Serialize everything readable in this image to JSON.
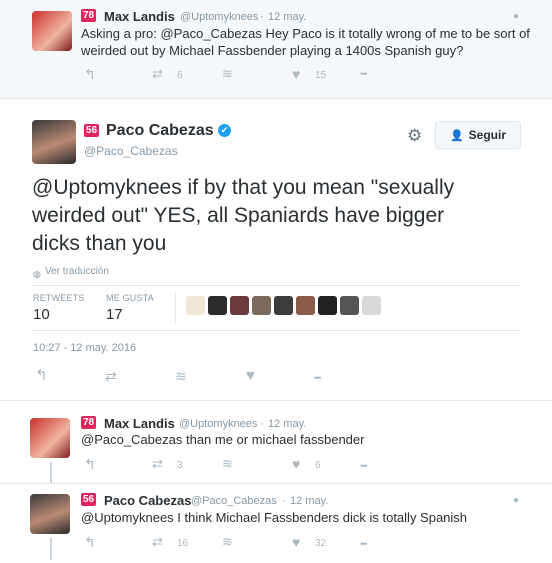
{
  "tweet1": {
    "rank": "78",
    "name": "Max Landis",
    "handle": "@Uptomyknees",
    "separator": "·",
    "time": "12 may.",
    "text_line1": "Asking a pro: @Paco_Cabezas Hey Paco is it totally wrong of me to be sort of",
    "text_line2": "weirded out by Michael Fassbender playing a 1400s Spanish guy?",
    "retweets": "6",
    "likes": "15"
  },
  "main_tweet": {
    "rank": "56",
    "name": "Paco Cabezas",
    "handle": "@Paco_Cabezas",
    "follow_label": "Seguir",
    "text_line1": "@Uptomyknees if by that you mean \"sexually",
    "text_line2": "weirded out\" YES, all Spaniards have bigger",
    "text_line3": "dicks than you",
    "translate": "Ver traducción",
    "retweets_label": "RETWEETS",
    "retweets": "10",
    "likes_label": "ME GUSTA",
    "likes": "17",
    "timestamp": "10:27 - 12 may. 2016"
  },
  "reply1": {
    "rank": "78",
    "name": "Max Landis",
    "handle": "@Uptomyknees",
    "separator": "·",
    "time": "12 may.",
    "text": "@Paco_Cabezas than me or michael fassbender",
    "retweets": "3",
    "likes": "6"
  },
  "reply2": {
    "rank": "56",
    "name": "Paco Cabezas",
    "handle": "@Paco_Cabezas",
    "separator": "·",
    "time": "12 may.",
    "text": "@Uptomyknees I think Michael Fassbenders dick is totally Spanish",
    "retweets": "16",
    "likes": "32"
  },
  "icons": {
    "reply": "↰",
    "retweet": "⇄",
    "stack": "≋",
    "like": "♥",
    "more": "•••",
    "gear": "⚙",
    "globe": "🌐"
  },
  "colors": {
    "accent": "#1da1f2",
    "badge": "#e0245e",
    "muted": "#8899a6"
  }
}
